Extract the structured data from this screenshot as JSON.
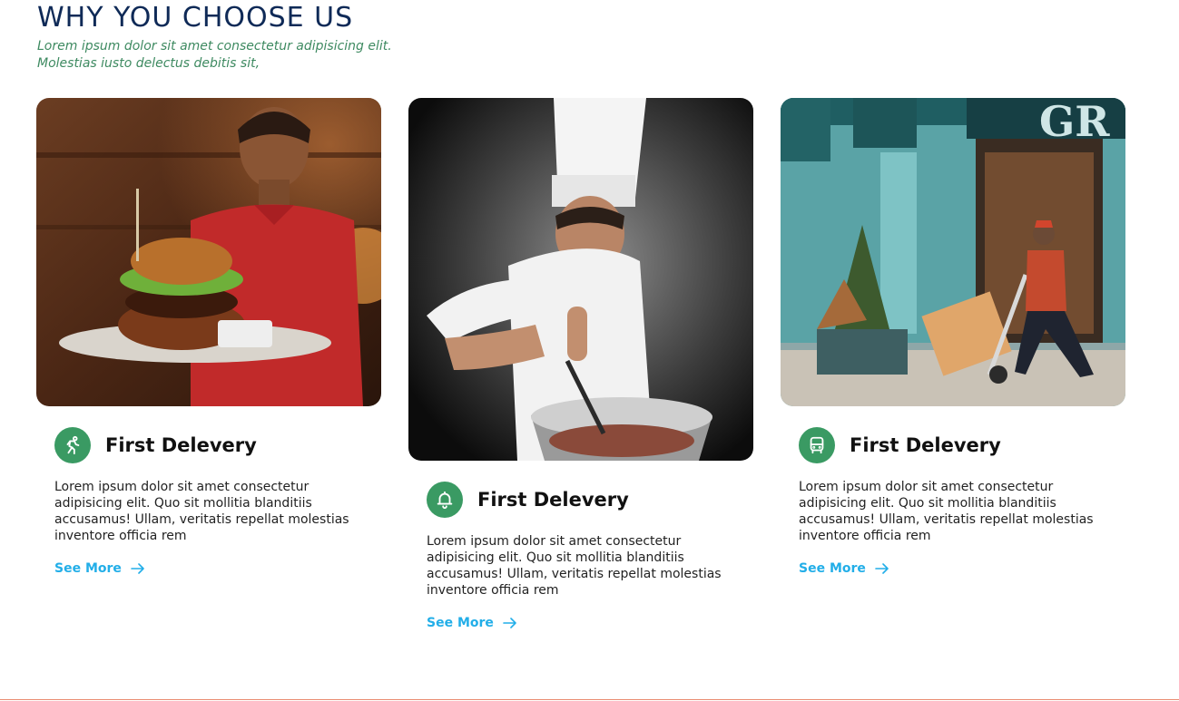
{
  "section": {
    "title": "WHY YOU CHOOSE US",
    "subtitle_line1": "Lorem ipsum dolor sit amet consectetur adipisicing elit.",
    "subtitle_line2": "Molestias iusto delectus debitis sit,"
  },
  "cards": [
    {
      "title": "First Delevery",
      "text": "Lorem ipsum dolor sit amet consectetur adipisicing elit. Quo sit mollitia blanditiis accusamus! Ullam, veritatis repellat molestias inventore officia rem",
      "link": "See More",
      "icon": "running-person-icon",
      "image": "waiter-holding-burger-photo"
    },
    {
      "title": "First Delevery",
      "text": "Lorem ipsum dolor sit amet consectetur adipisicing elit. Quo sit mollitia blanditiis accusamus! Ullam, veritatis repellat molestias inventore officia rem",
      "link": "See More",
      "icon": "bell-icon",
      "image": "chef-cooking-photo"
    },
    {
      "title": "First Delevery",
      "text": "Lorem ipsum dolor sit amet consectetur adipisicing elit. Quo sit mollitia blanditiis accusamus! Ullam, veritatis repellat molestias inventore officia rem",
      "link": "See More",
      "icon": "bus-icon",
      "image": "courier-delivering-boxes-photo"
    }
  ],
  "colors": {
    "title": "#0f2a57",
    "subtitle": "#3e8a61",
    "badge": "#3a9a63",
    "link": "#22aee8",
    "divider": "#e98a6e"
  }
}
